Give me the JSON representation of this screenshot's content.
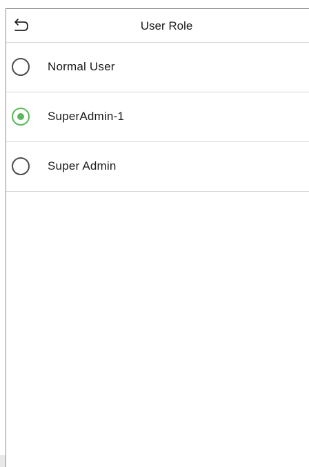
{
  "header": {
    "title": "User Role",
    "back_icon": "back-arrow-icon"
  },
  "options": [
    {
      "label": "Normal User",
      "selected": false
    },
    {
      "label": "SuperAdmin-1",
      "selected": true
    },
    {
      "label": "Super Admin",
      "selected": false
    }
  ],
  "colors": {
    "accent": "#5ab85a",
    "divider": "#d8d8d8",
    "text": "#1a1a1a"
  }
}
